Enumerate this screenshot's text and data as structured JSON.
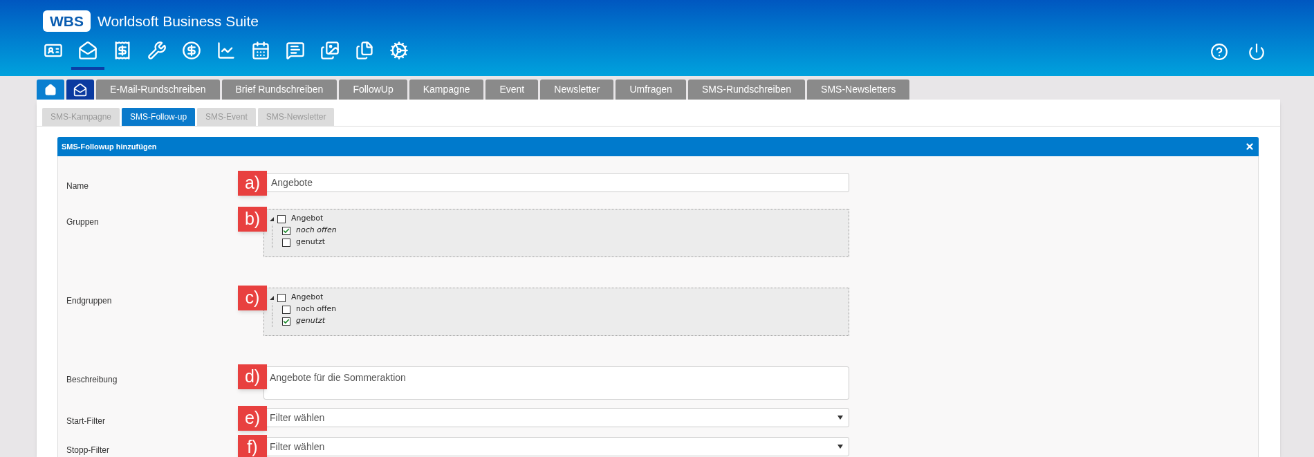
{
  "app": {
    "logo": "WBS",
    "title": "Worldsoft Business Suite"
  },
  "modules": [
    {
      "kind": "contact-card",
      "selected": false
    },
    {
      "kind": "mail",
      "selected": true
    },
    {
      "kind": "invoice",
      "selected": false
    },
    {
      "kind": "tools",
      "selected": false
    },
    {
      "kind": "finance",
      "selected": false
    },
    {
      "kind": "chart",
      "selected": false
    },
    {
      "kind": "calendar",
      "selected": false
    },
    {
      "kind": "message",
      "selected": false
    },
    {
      "kind": "gallery",
      "selected": false
    },
    {
      "kind": "document",
      "selected": false
    },
    {
      "kind": "settings",
      "selected": false
    }
  ],
  "main_tabs": [
    {
      "kind": "home",
      "selected": false
    },
    {
      "kind": "mail",
      "selected": true
    },
    {
      "kind": "text",
      "label": "E-Mail-Rundschreiben",
      "selected": false
    },
    {
      "kind": "text",
      "label": "Brief Rundschreiben",
      "selected": false
    },
    {
      "kind": "text",
      "label": "FollowUp",
      "selected": false
    },
    {
      "kind": "text",
      "label": "Kampagne",
      "selected": false
    },
    {
      "kind": "text",
      "label": "Event",
      "selected": false
    },
    {
      "kind": "text",
      "label": "Newsletter",
      "selected": false
    },
    {
      "kind": "text",
      "label": "Umfragen",
      "selected": false
    },
    {
      "kind": "text",
      "label": "SMS-Rundschreiben",
      "selected": false
    },
    {
      "kind": "text",
      "label": "SMS-Newsletters",
      "selected": false
    }
  ],
  "sub_tabs": [
    {
      "label": "SMS-Kampagne",
      "selected": false
    },
    {
      "label": "SMS-Follow-up",
      "selected": true
    },
    {
      "label": "SMS-Event",
      "selected": false
    },
    {
      "label": "SMS-Newsletter",
      "selected": false
    }
  ],
  "dialog": {
    "title": "SMS-Followup hinzufügen",
    "fields": [
      {
        "kind": "text",
        "label": "Name",
        "annotation": "a)",
        "value": "Angebote"
      },
      {
        "kind": "tree",
        "label": "Gruppen",
        "annotation": "b)",
        "tree": [
          {
            "label": "Angebot",
            "checked": false,
            "expanded": true,
            "children": [
              {
                "label": "noch offen",
                "checked": true
              },
              {
                "label": "genutzt",
                "checked": false
              }
            ]
          }
        ]
      },
      {
        "kind": "tree",
        "label": "Endgruppen",
        "annotation": "c)",
        "tree": [
          {
            "label": "Angebot",
            "checked": false,
            "expanded": true,
            "children": [
              {
                "label": "noch offen",
                "checked": false
              },
              {
                "label": "genutzt",
                "checked": true
              }
            ]
          }
        ]
      },
      {
        "kind": "textarea",
        "label": "Beschreibung",
        "annotation": "d)",
        "value": "Angebote für die Sommeraktion"
      },
      {
        "kind": "select",
        "label": "Start-Filter",
        "annotation": "e)",
        "value": "Filter wählen"
      },
      {
        "kind": "select",
        "label": "Stopp-Filter",
        "annotation": "f)",
        "value": "Filter wählen"
      }
    ]
  }
}
